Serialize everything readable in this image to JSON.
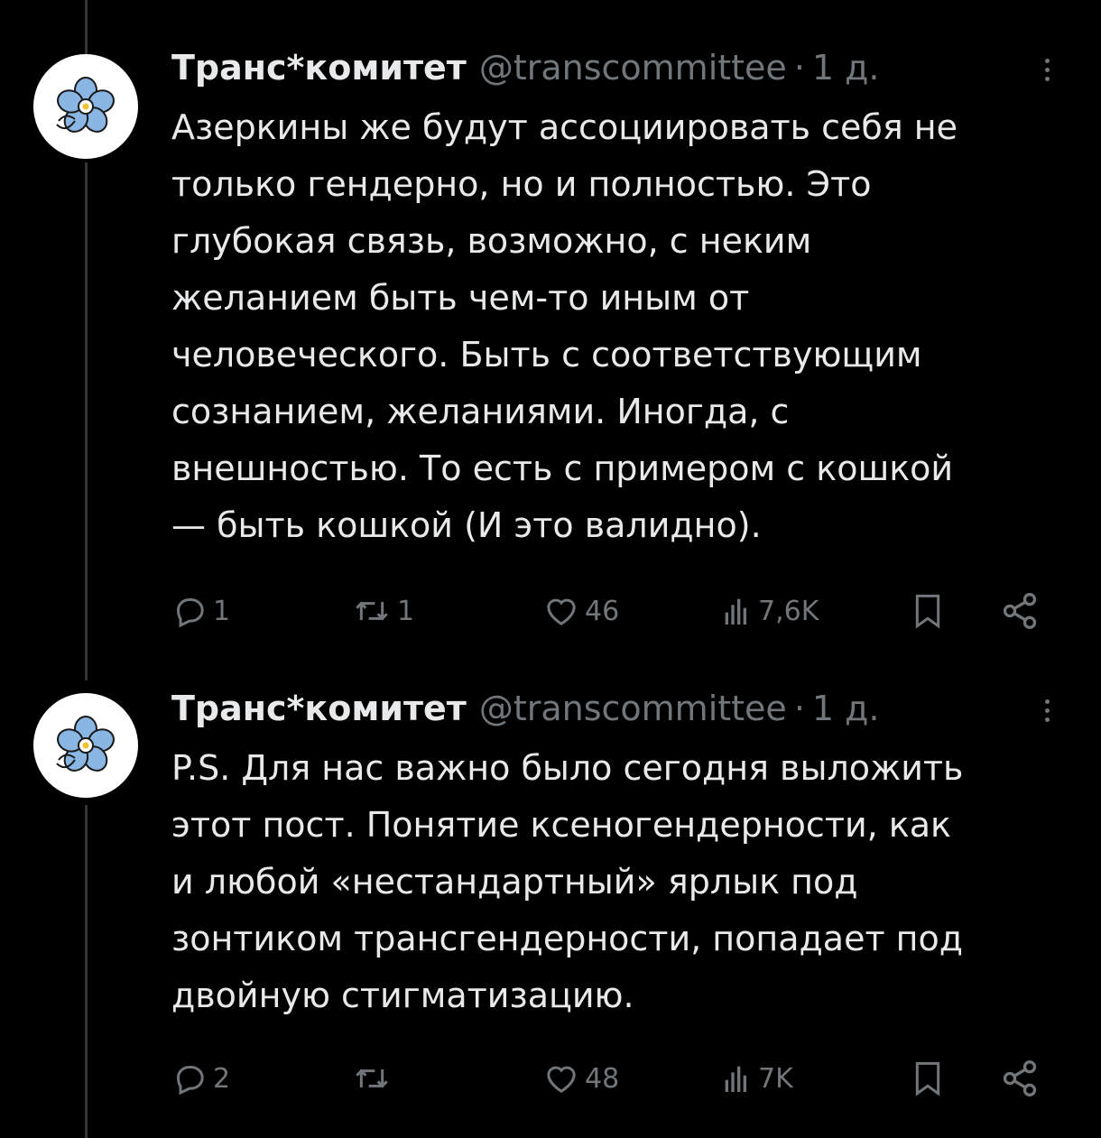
{
  "tweets": [
    {
      "name": "Транс*комитет",
      "handle": "@transcommittee",
      "separator": "·",
      "time": "1 д.",
      "lines": [
        "Азеркины же будут ассоциировать себя не",
        "только гендерно, но и полностью. Это",
        "глубокая связь, возможно, с неким",
        "желанием быть чем-то иным от",
        "человеческого. Быть с соответствующим",
        "сознанием, желаниями. Иногда, с",
        "внешностью. То есть с примером с кошкой",
        "— быть кошкой (И это валидно)."
      ],
      "replies": "1",
      "retweets": "1",
      "likes": "46",
      "views": "7,6K"
    },
    {
      "name": "Транс*комитет",
      "handle": "@transcommittee",
      "separator": "·",
      "time": "1 д.",
      "lines": [
        "P.S. Для нас важно было сегодня выложить",
        "этот пост. Понятие ксеногендерности, как",
        "и любой «нестандартный» ярлык под",
        "зонтиком трансгендерности, попадает под",
        "двойную стигматизацию."
      ],
      "replies": "2",
      "retweets": "",
      "likes": "48",
      "views": "7K"
    }
  ],
  "colors": {
    "background": "#000000",
    "text": "#e7e9ea",
    "muted": "#71767b",
    "thread_line": "#333639",
    "avatar_flower": "#8ab6e3"
  },
  "icons": [
    "reply-icon",
    "retweet-icon",
    "like-icon",
    "views-icon",
    "bookmark-icon",
    "share-icon",
    "more-icon",
    "forget-me-not-avatar"
  ]
}
